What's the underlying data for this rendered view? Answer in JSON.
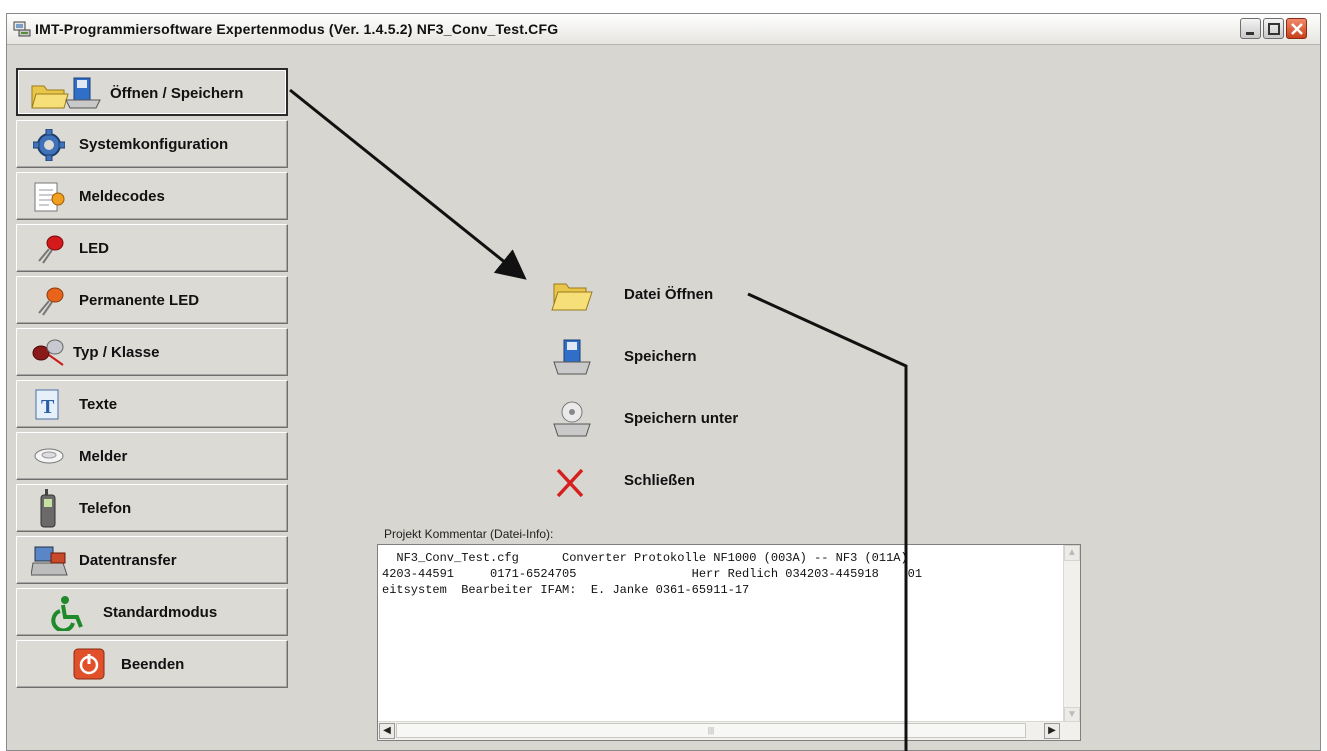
{
  "window": {
    "title": "IMT-Programmiersoftware Expertenmodus (Ver. 1.4.5.2) NF3_Conv_Test.CFG"
  },
  "sidebar": {
    "items": [
      {
        "label": "Öffnen / Speichern",
        "icon": "open-save-icon"
      },
      {
        "label": "Systemkonfiguration",
        "icon": "gear-icon"
      },
      {
        "label": "Meldecodes",
        "icon": "notepad-icon"
      },
      {
        "label": "LED",
        "icon": "led-red-icon"
      },
      {
        "label": "Permanente LED",
        "icon": "led-orange-icon"
      },
      {
        "label": "Typ / Klasse",
        "icon": "led-pair-icon"
      },
      {
        "label": "Texte",
        "icon": "text-document-icon"
      },
      {
        "label": "Melder",
        "icon": "detector-icon"
      },
      {
        "label": "Telefon",
        "icon": "phone-icon"
      },
      {
        "label": "Datentransfer",
        "icon": "data-transfer-icon"
      },
      {
        "label": "Standardmodus",
        "icon": "wheelchair-icon"
      },
      {
        "label": "Beenden",
        "icon": "power-icon"
      }
    ]
  },
  "actions": [
    {
      "label": "Datei Öffnen",
      "icon": "folder-icon"
    },
    {
      "label": "Speichern",
      "icon": "save-disk-icon"
    },
    {
      "label": "Speichern unter",
      "icon": "save-as-disk-icon"
    },
    {
      "label": "Schließen",
      "icon": "close-x-icon"
    }
  ],
  "comment": {
    "label": "Projekt Kommentar (Datei-Info):",
    "lines": [
      "  NF3_Conv_Test.cfg      Converter Protokolle NF1000 (003A) -- NF3 (011A)",
      "4203-44591     0171-6524705                Herr Redlich 034203-445918    01",
      "eitsystem  Bearbeiter IFAM:  E. Janke 0361-65911-17"
    ]
  },
  "colors": {
    "window_bg": "#d8d6d0",
    "close_button": "#c9401b",
    "close_x": "#d62020"
  }
}
